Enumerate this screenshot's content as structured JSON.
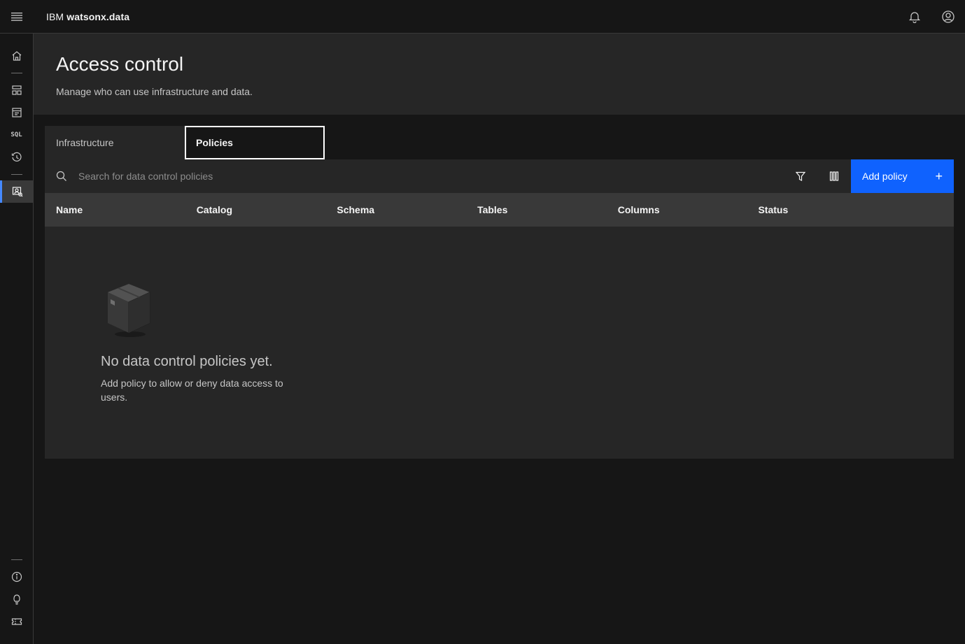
{
  "header": {
    "brand_prefix": "IBM",
    "brand_product": "watsonx.data",
    "icons": [
      "menu-icon",
      "notification-icon",
      "user-avatar-icon"
    ]
  },
  "sidenav": {
    "items": [
      {
        "name": "home",
        "icon": "home-icon"
      },
      {
        "name": "infrastructure-manager",
        "icon": "infrastructure-icon"
      },
      {
        "name": "data-manager",
        "icon": "data-manager-icon"
      },
      {
        "name": "sql",
        "label": "SQL",
        "icon": "sql-icon"
      },
      {
        "name": "query-history",
        "icon": "history-icon"
      },
      {
        "name": "access-control",
        "icon": "access-control-icon",
        "active": true
      },
      {
        "name": "about",
        "icon": "info-icon"
      },
      {
        "name": "help",
        "icon": "lightbulb-icon"
      },
      {
        "name": "tickets",
        "icon": "ticket-icon"
      }
    ]
  },
  "page": {
    "title": "Access control",
    "subtitle": "Manage who can use infrastructure and data."
  },
  "tabs": [
    {
      "label": "Infrastructure",
      "selected": false
    },
    {
      "label": "Policies",
      "selected": true
    }
  ],
  "toolbar": {
    "search_placeholder": "Search for data control policies",
    "add_label": "Add policy",
    "add_icon": "+"
  },
  "table": {
    "columns": [
      "Name",
      "Catalog",
      "Schema",
      "Tables",
      "Columns",
      "Status"
    ],
    "rows": []
  },
  "empty_state": {
    "title": "No data control policies yet.",
    "body": "Add policy to allow or deny data access to users."
  },
  "colors": {
    "background": "#161616",
    "layer": "#262626",
    "table_header": "#393939",
    "primary_button": "#0f62fe",
    "active_nav_border": "#4589ff"
  }
}
